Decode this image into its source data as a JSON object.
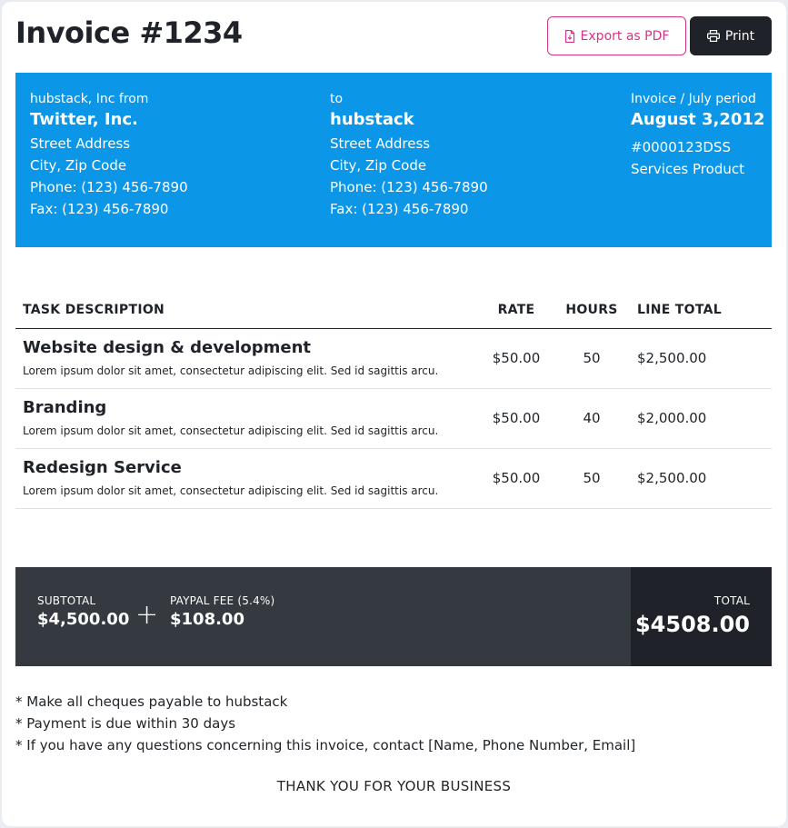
{
  "title": "Invoice #1234",
  "buttons": {
    "export_label": "Export as PDF",
    "print_label": "Print"
  },
  "from": {
    "sender": "hubstack, Inc",
    "label": "from",
    "name": "Twitter, Inc.",
    "street": "Street Address",
    "city": "City, Zip Code",
    "phone": "Phone: (123) 456-7890",
    "fax": "Fax: (123) 456-7890"
  },
  "to": {
    "label": "to",
    "name": "hubstack",
    "street": "Street Address",
    "city": "City, Zip Code",
    "phone": "Phone: (123) 456-7890",
    "fax": "Fax: (123) 456-7890"
  },
  "invoice": {
    "period": "Invoice / July period",
    "date": "August 3,2012",
    "number": "#0000123DSS",
    "product": "Services Product"
  },
  "table": {
    "headers": [
      "TASK DESCRIPTION",
      "RATE",
      "HOURS",
      "LINE TOTAL"
    ],
    "rows": [
      {
        "title": "Website design & development",
        "desc": "Lorem ipsum dolor sit amet, consectetur adipiscing elit. Sed id sagittis arcu.",
        "rate": "$50.00",
        "hours": "50",
        "total": "$2,500.00"
      },
      {
        "title": "Branding",
        "desc": "Lorem ipsum dolor sit amet, consectetur adipiscing elit. Sed id sagittis arcu.",
        "rate": "$50.00",
        "hours": "40",
        "total": "$2,000.00"
      },
      {
        "title": "Redesign Service",
        "desc": "Lorem ipsum dolor sit amet, consectetur adipiscing elit. Sed id sagittis arcu.",
        "rate": "$50.00",
        "hours": "50",
        "total": "$2,500.00"
      }
    ]
  },
  "totals": {
    "subtotal_label": "SUBTOTAL",
    "subtotal": "$4,500.00",
    "plus": "+",
    "fee_label": "PAYPAL FEE (5.4%)",
    "fee": "$108.00",
    "total_label": "TOTAL",
    "total": "$4508.00"
  },
  "notes": [
    "* Make all cheques payable to hubstack",
    "* Payment is due within 30 days",
    "* If you have any questions concerning this invoice, contact [Name, Phone Number, Email]"
  ],
  "thanks": "THANK YOU FOR YOUR BUSINESS",
  "colors": {
    "header_band": "#0b96e8",
    "totals_band": "#343a40",
    "total_box": "#1f2329",
    "accent": "#d63384"
  },
  "icons": {
    "export": "file-pdf-icon",
    "print": "printer-icon"
  }
}
